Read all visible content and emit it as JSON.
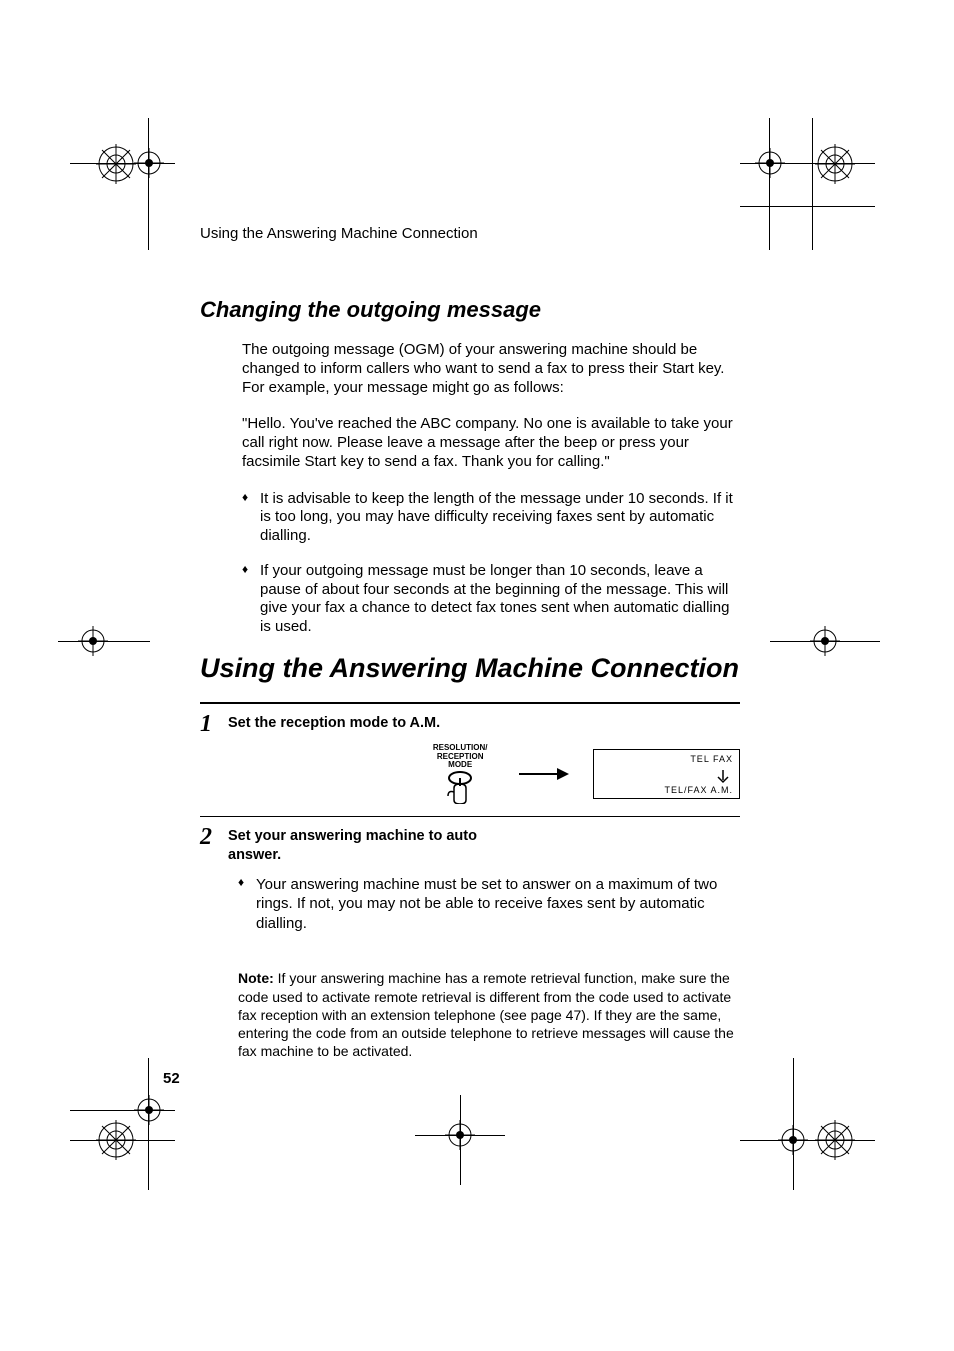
{
  "running_head": "Using the Answering Machine Connection",
  "section_heading": "Changing the outgoing message",
  "para1": "The outgoing message (OGM) of your answering machine should be changed to inform callers who want to send a fax to press their Start key. For example, your message might go as follows:",
  "para2": "\"Hello. You've reached the ABC company. No one is available to take your call right now. Please leave a message after the beep or press your facsimile Start key to send a fax. Thank you for calling.\"",
  "bullets": [
    "It is advisable to keep the length of the message under 10 seconds. If it is too long, you may have difficulty receiving faxes sent by automatic dialling.",
    "If your outgoing message must be longer than 10 seconds, leave a pause of about four seconds at the beginning of the message. This will give your fax a chance to detect fax tones sent when automatic dialling is used."
  ],
  "chapter_heading": "Using the Answering Machine Connection",
  "steps": [
    {
      "num": "1",
      "text": "Set the reception mode to A.M."
    },
    {
      "num": "2",
      "text": "Set your answering machine to auto answer."
    }
  ],
  "button_label_line1": "RESOLUTION/",
  "button_label_line2": "RECEPTION MODE",
  "lcd_top": "TEL   FAX",
  "lcd_bottom": "TEL/FAX   A.M.",
  "step2_bullet": "Your answering machine must be set to answer on a maximum of two rings. If not, you may not be able to receive faxes sent by automatic dialling.",
  "note_label": "Note:",
  "note_text": " If your answering machine has a remote retrieval function, make sure the code used to activate remote retrieval is different from the code used to activate fax reception with an extension telephone (see page 47). If they are the same, entering the code from an outside telephone to retrieve messages will cause the fax machine to be activated.",
  "page_number": "52"
}
